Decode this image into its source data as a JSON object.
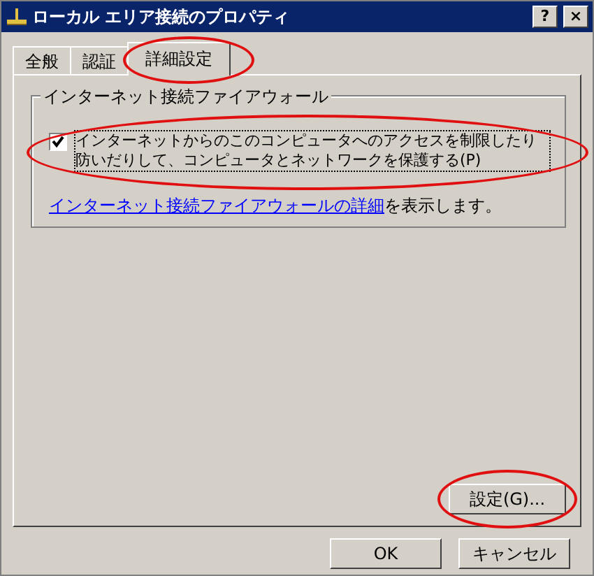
{
  "window": {
    "title": "ローカル エリア接続のプロパティ",
    "buttons": [
      "?",
      "×"
    ]
  },
  "tabs": [
    {
      "label": "全般",
      "selected": false,
      "highlighted": false
    },
    {
      "label": "認証",
      "selected": false,
      "highlighted": false
    },
    {
      "label": "詳細設定",
      "selected": true,
      "highlighted": true
    }
  ],
  "group": {
    "title": "インターネット接続ファイアウォール",
    "checkbox": {
      "label": "インターネットからのこのコンピュータへのアクセスを制限したり防いだりして、コンピュータとネットワークを保護する(P)",
      "checked": true,
      "highlighted": true
    },
    "link": "インターネット接続ファイアウォールの詳細",
    "link_suffix": "を表示します。"
  },
  "settings_button": {
    "label": "設定(G)...",
    "highlighted": true
  },
  "buttons": [
    "OK",
    "キャンセル"
  ]
}
